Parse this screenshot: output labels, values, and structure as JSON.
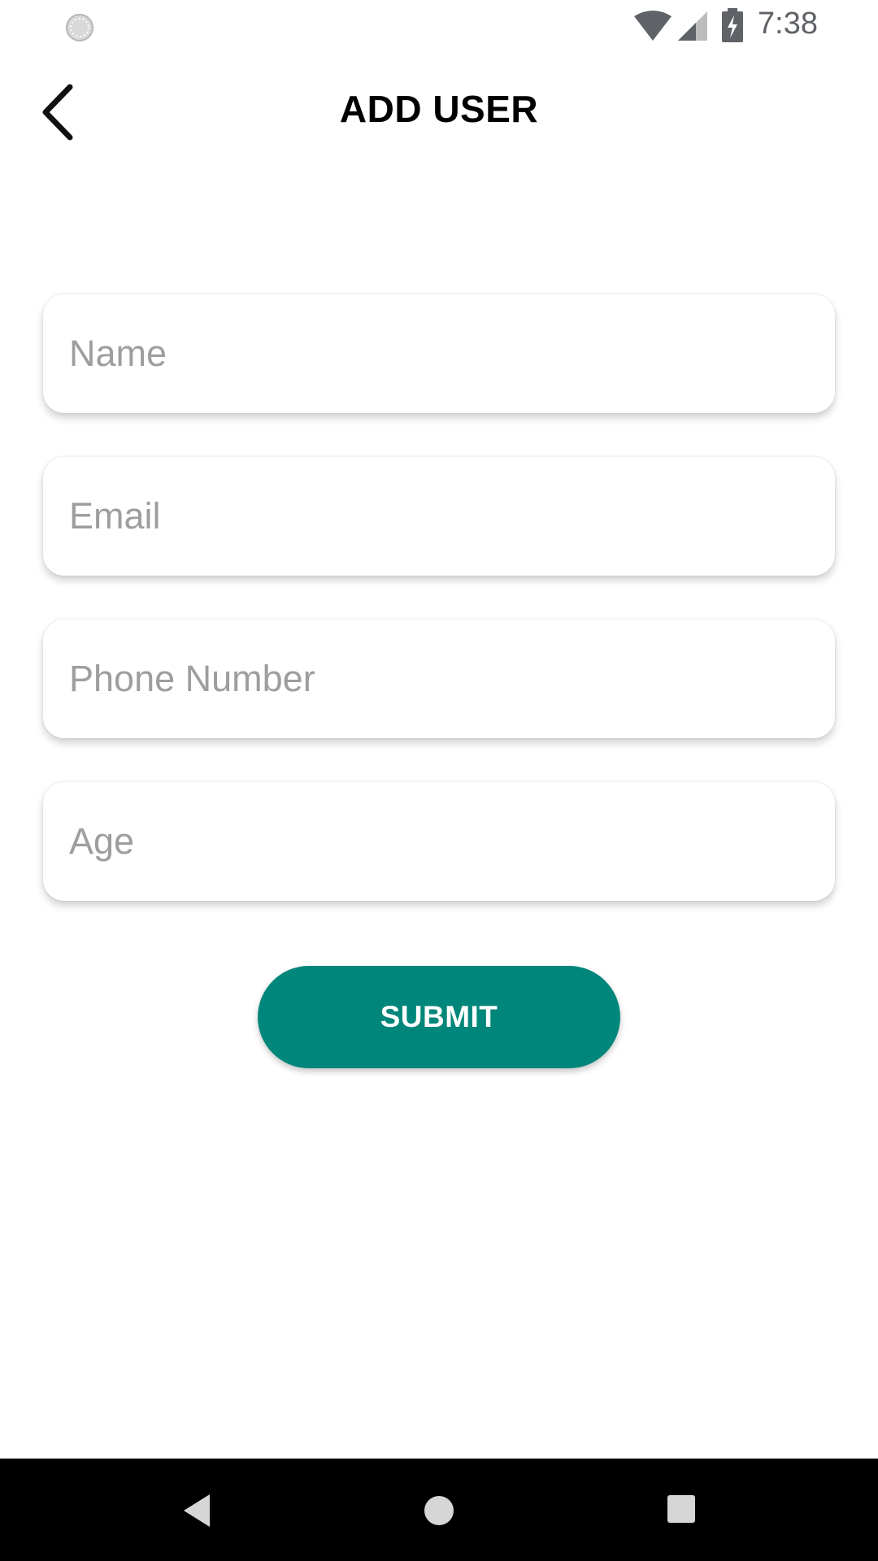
{
  "status_bar": {
    "time": "7:38",
    "icons": [
      "sync-circle-icon",
      "wifi-icon",
      "cell-signal-icon",
      "battery-charging-icon"
    ]
  },
  "app_bar": {
    "title": "ADD USER",
    "back_icon": "chevron-left-icon"
  },
  "form": {
    "fields": [
      {
        "name": "name",
        "value": "",
        "placeholder": "Name"
      },
      {
        "name": "email",
        "value": "",
        "placeholder": "Email"
      },
      {
        "name": "phone",
        "value": "",
        "placeholder": "Phone Number"
      },
      {
        "name": "age",
        "value": "",
        "placeholder": "Age"
      }
    ],
    "submit_label": "SUBMIT"
  },
  "nav_bar": {
    "icons": [
      "nav-back-icon",
      "nav-home-icon",
      "nav-recents-icon"
    ]
  },
  "colors": {
    "accent": "#00867a",
    "background": "#ffffff",
    "placeholder": "#9e9e9e",
    "nav_bar": "#000000",
    "title": "#000000"
  }
}
